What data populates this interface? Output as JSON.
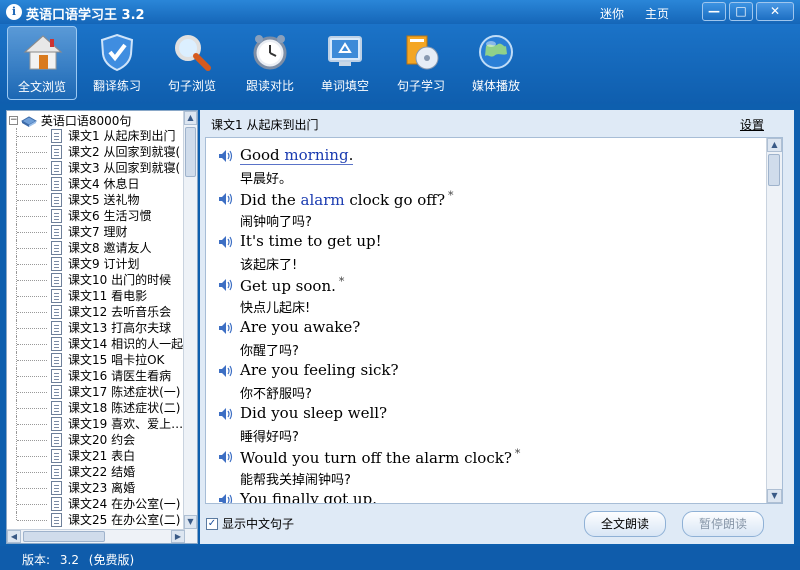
{
  "app": {
    "title": "英语口语学习王 3.2",
    "mini_label": "迷你",
    "home_label": "主页",
    "icon_letter": "i"
  },
  "window_controls": {
    "minimize": "—",
    "maximize": "□",
    "close": "✕"
  },
  "toolbar": {
    "items": [
      {
        "label": "全文浏览",
        "icon": "house-icon",
        "active": true
      },
      {
        "label": "翻译练习",
        "icon": "shield-icon",
        "active": false
      },
      {
        "label": "句子浏览",
        "icon": "magnifier-icon",
        "active": false
      },
      {
        "label": "跟读对比",
        "icon": "alarm-clock-icon",
        "active": false
      },
      {
        "label": "单词填空",
        "icon": "monitor-recycle-icon",
        "active": false
      },
      {
        "label": "句子学习",
        "icon": "book-cd-icon",
        "active": false
      },
      {
        "label": "媒体播放",
        "icon": "globe-icon",
        "active": false
      }
    ]
  },
  "tree": {
    "root": "英语口语8000句",
    "items": [
      "课文1  从起床到出门",
      "课文2  从回家到就寝(",
      "课文3  从回家到就寝(",
      "课文4  休息日",
      "课文5  送礼物",
      "课文6  生活习惯",
      "课文7  理财",
      "课文8  邀请友人",
      "课文9  订计划",
      "课文10  出门的时候",
      "课文11  看电影",
      "课文12  去听音乐会",
      "课文13  打高尔夫球",
      "课文14  相识的人一起",
      "课文15  唱卡拉OK",
      "课文16  请医生看病",
      "课文17  陈述症状(一)",
      "课文18  陈述症状(二)",
      "课文19  喜欢、爱上…",
      "课文20  约会",
      "课文21  表白",
      "课文22  结婚",
      "课文23  离婚",
      "课文24  在办公室(一)",
      "课文25  在办公室(二)"
    ]
  },
  "content": {
    "lesson_title": "课文1  从起床到出门",
    "settings_label": "设置",
    "sentences": [
      {
        "en": "Good morning.",
        "zh": "早晨好。"
      },
      {
        "en": "Did the alarm clock go off?",
        "star": "*",
        "zh": "闹钟响了吗?"
      },
      {
        "en": "It's time to get up!",
        "zh": "该起床了!"
      },
      {
        "en": "Get up soon.",
        "star": "*",
        "zh": "快点儿起床!"
      },
      {
        "en": "Are you awake?",
        "zh": "你醒了吗?"
      },
      {
        "en": "Are you feeling sick?",
        "zh": "你不舒服吗?"
      },
      {
        "en": "Did you sleep well?",
        "zh": "睡得好吗?"
      },
      {
        "en": "Would you turn off the alarm clock?",
        "star": "*",
        "zh": "能帮我关掉闹钟吗?"
      },
      {
        "en": "You finally got up.",
        "zh": ""
      }
    ],
    "show_chinese_label": "显示中文句子",
    "show_chinese_checked": true,
    "read_all_label": "全文朗读",
    "pause_label": "暂停朗读"
  },
  "status": {
    "version_label": "版本:",
    "version": "3.2",
    "edition": "(免费版)"
  },
  "colors": {
    "chrome_blue": "#0e5fae",
    "highlight_word": "#1a3bb0"
  }
}
